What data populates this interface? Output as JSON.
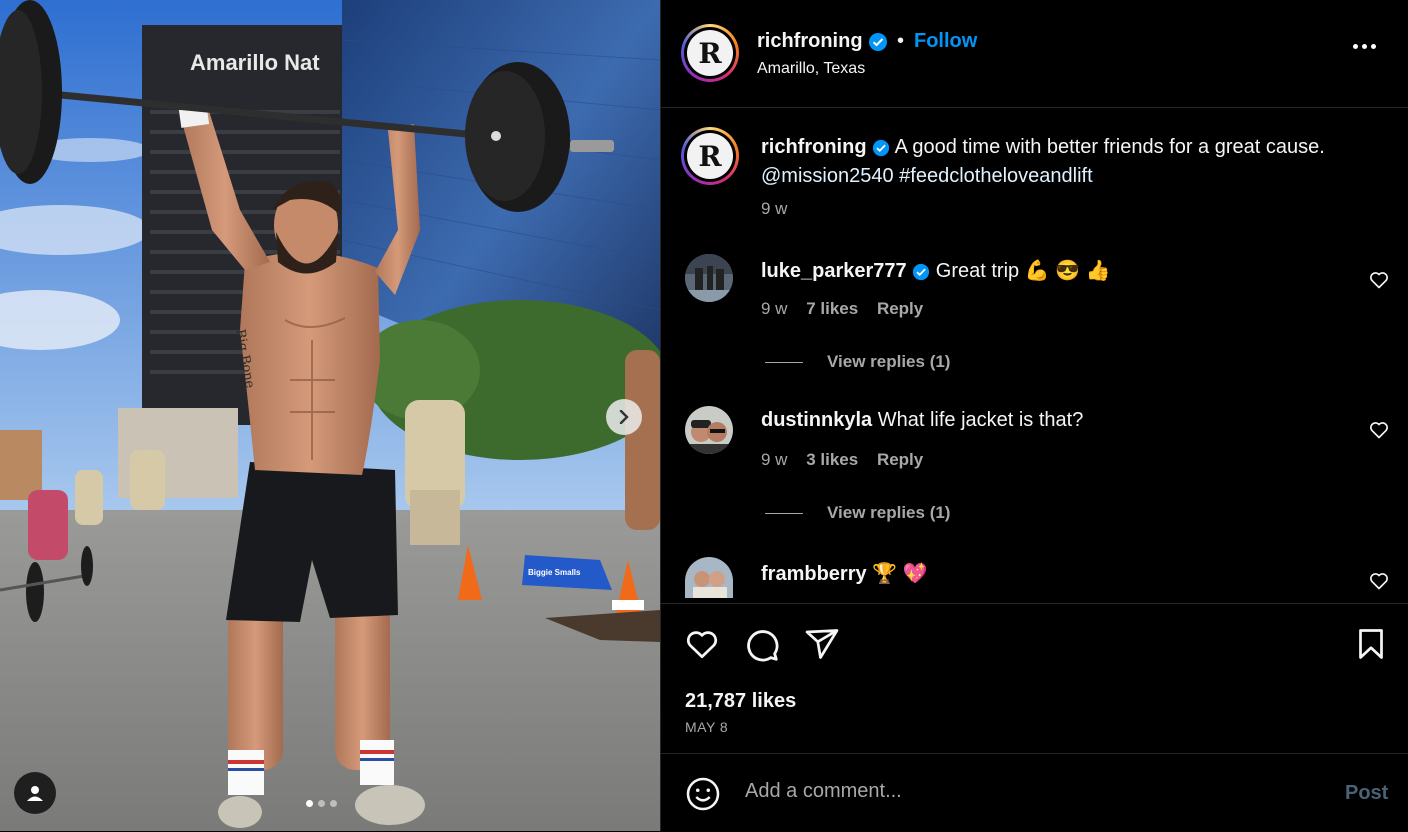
{
  "post": {
    "username": "richfroning",
    "follow_label": "Follow",
    "separator": "•",
    "location": "Amarillo, Texas",
    "avatar_letter": "R",
    "caption": "A good time with better friends for a great cause.",
    "caption_tags": "@mission2540 #feedclotheloveandlift",
    "time_ago": "9 w"
  },
  "media": {
    "building_sign": "Amarillo Nat",
    "tattoo_text": "Big Bone",
    "barrier_text": "Biggie Smalls",
    "dots": 3,
    "active_dot": 0
  },
  "comments": [
    {
      "username": "luke_parker777",
      "verified": true,
      "text": "Great trip 💪 😎 👍",
      "time": "9 w",
      "likes": "7 likes",
      "reply": "Reply",
      "view_replies": "View replies (1)"
    },
    {
      "username": "dustinnkyla",
      "verified": false,
      "text": "What life jacket is that?",
      "time": "9 w",
      "likes": "3 likes",
      "reply": "Reply",
      "view_replies": "View replies (1)"
    },
    {
      "username": "frambberry",
      "verified": false,
      "text": "🏆 💖"
    }
  ],
  "footer": {
    "likes": "21,787 likes",
    "date": "MAY 8",
    "comment_placeholder": "Add a comment...",
    "post_label": "Post"
  },
  "colors": {
    "accent": "#0095f6",
    "background": "#000000",
    "secondary_text": "#a8a8a8"
  }
}
